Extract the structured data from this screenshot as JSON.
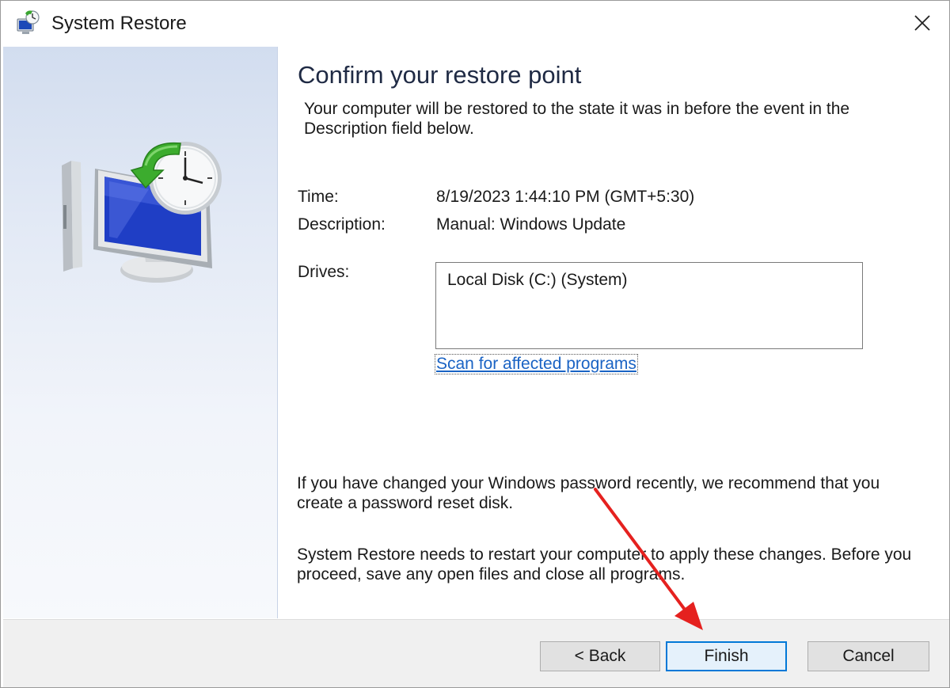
{
  "window": {
    "title": "System Restore",
    "close_glyph": "✕"
  },
  "icons": {
    "title_icon": "system-restore-icon",
    "hero_icon": "restore-computer-clock-icon",
    "close_icon": "close-icon"
  },
  "main": {
    "heading": "Confirm your restore point",
    "intro": "Your computer will be restored to the state it was in before the event in the Description field below.",
    "time_label": "Time:",
    "time_value": "8/19/2023 1:44:10 PM (GMT+5:30)",
    "description_label": "Description:",
    "description_value": "Manual: Windows Update",
    "drives_label": "Drives:",
    "drives": [
      "Local Disk (C:) (System)"
    ],
    "scan_link": "Scan for affected programs",
    "password_note": "If you have changed your Windows password recently, we recommend that you create a password reset disk.",
    "restart_note": "System Restore needs to restart your computer to apply these changes. Before you proceed, save any open files and close all programs."
  },
  "footer": {
    "back_label": "< Back",
    "finish_label": "Finish",
    "cancel_label": "Cancel"
  },
  "colors": {
    "link": "#1a63c4",
    "annotation_arrow": "#e5211f",
    "default_button_border": "#0078d7"
  }
}
